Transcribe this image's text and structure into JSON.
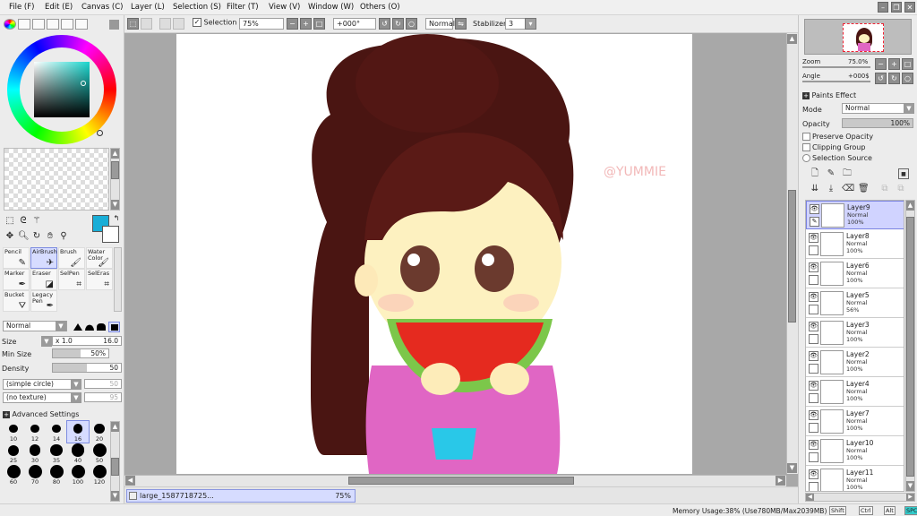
{
  "menu": [
    {
      "label": "File (F)"
    },
    {
      "label": "Edit (E)"
    },
    {
      "label": "Canvas (C)"
    },
    {
      "label": "Layer (L)"
    },
    {
      "label": "Selection (S)"
    },
    {
      "label": "Filter (T)"
    },
    {
      "label": "View (V)"
    },
    {
      "label": "Window (W)"
    },
    {
      "label": "Others (O)"
    }
  ],
  "toolbar": {
    "selection_label": "Selection",
    "zoom_value": "75%",
    "angle_value": "+000°",
    "blend_value": "Normal",
    "stabilizer_label": "Stabilizer",
    "stabilizer_value": "3"
  },
  "colors": {
    "primary": "#19aed7",
    "secondary": "#ffffff",
    "selection": "#d6dcff"
  },
  "brushes": [
    {
      "label": "Pencil",
      "icon": "pencil-icon"
    },
    {
      "label": "AirBrush",
      "icon": "airbrush-icon",
      "selected": true
    },
    {
      "label": "Brush",
      "icon": "brush-icon"
    },
    {
      "label": "Water Color",
      "icon": "watercolor-icon"
    },
    {
      "label": "Marker",
      "icon": "marker-icon"
    },
    {
      "label": "Eraser",
      "icon": "eraser-icon"
    },
    {
      "label": "SelPen",
      "icon": "selpen-icon"
    },
    {
      "label": "SelEras",
      "icon": "seleras-icon"
    },
    {
      "label": "Bucket",
      "icon": "bucket-icon"
    },
    {
      "label": "Legacy Pen",
      "icon": "legacy-pen-icon"
    }
  ],
  "brush_settings": {
    "mode": "Normal",
    "size_label": "Size",
    "size_mult": "x 1.0",
    "size_value": "16.0",
    "minsize_label": "Min Size",
    "minsize_value": "50%",
    "minsize_fraction": 0.5,
    "density_label": "Density",
    "density_value": "50",
    "density_fraction": 0.5,
    "shape": "(simple circle)",
    "shape_value": "50",
    "texture": "(no texture)",
    "texture_value": "95",
    "advanced_label": "Advanced Settings"
  },
  "brush_sizes": [
    "10",
    "12",
    "14",
    "16",
    "20",
    "25",
    "30",
    "35",
    "40",
    "50",
    "60",
    "70",
    "80",
    "100",
    "120"
  ],
  "selected_size": "16",
  "canvas": {
    "watermark": "@YUMMIE"
  },
  "file_tab": {
    "name": "large_1587718725...",
    "zoom": "75%"
  },
  "navigator": {
    "zoom_label": "Zoom",
    "zoom_value": "75.0%",
    "angle_label": "Angle",
    "angle_value": "+000$"
  },
  "layer_props": {
    "paints_effect": "Paints Effect",
    "mode_label": "Mode",
    "mode_value": "Normal",
    "opacity_label": "Opacity",
    "opacity_value": "100%",
    "preserve_opacity": "Preserve Opacity",
    "clipping_group": "Clipping Group",
    "selection_source": "Selection Source"
  },
  "layers": [
    {
      "name": "Layer9",
      "mode": "Normal",
      "opacity": "100%",
      "selected": true
    },
    {
      "name": "Layer8",
      "mode": "Normal",
      "opacity": "100%"
    },
    {
      "name": "Layer6",
      "mode": "Normal",
      "opacity": "100%"
    },
    {
      "name": "Layer5",
      "mode": "Normal",
      "opacity": "56%"
    },
    {
      "name": "Layer3",
      "mode": "Normal",
      "opacity": "100%"
    },
    {
      "name": "Layer2",
      "mode": "Normal",
      "opacity": "100%"
    },
    {
      "name": "Layer4",
      "mode": "Normal",
      "opacity": "100%"
    },
    {
      "name": "Layer7",
      "mode": "Normal",
      "opacity": "100%"
    },
    {
      "name": "Layer10",
      "mode": "Normal",
      "opacity": "100%"
    },
    {
      "name": "Layer11",
      "mode": "Normal",
      "opacity": "100%"
    }
  ],
  "status": {
    "memory": "Memory Usage:38% (Use780MB/Max2039MB)",
    "keys": [
      "Shift",
      "Ctrl",
      "Alt",
      "SPC",
      "Any"
    ]
  }
}
